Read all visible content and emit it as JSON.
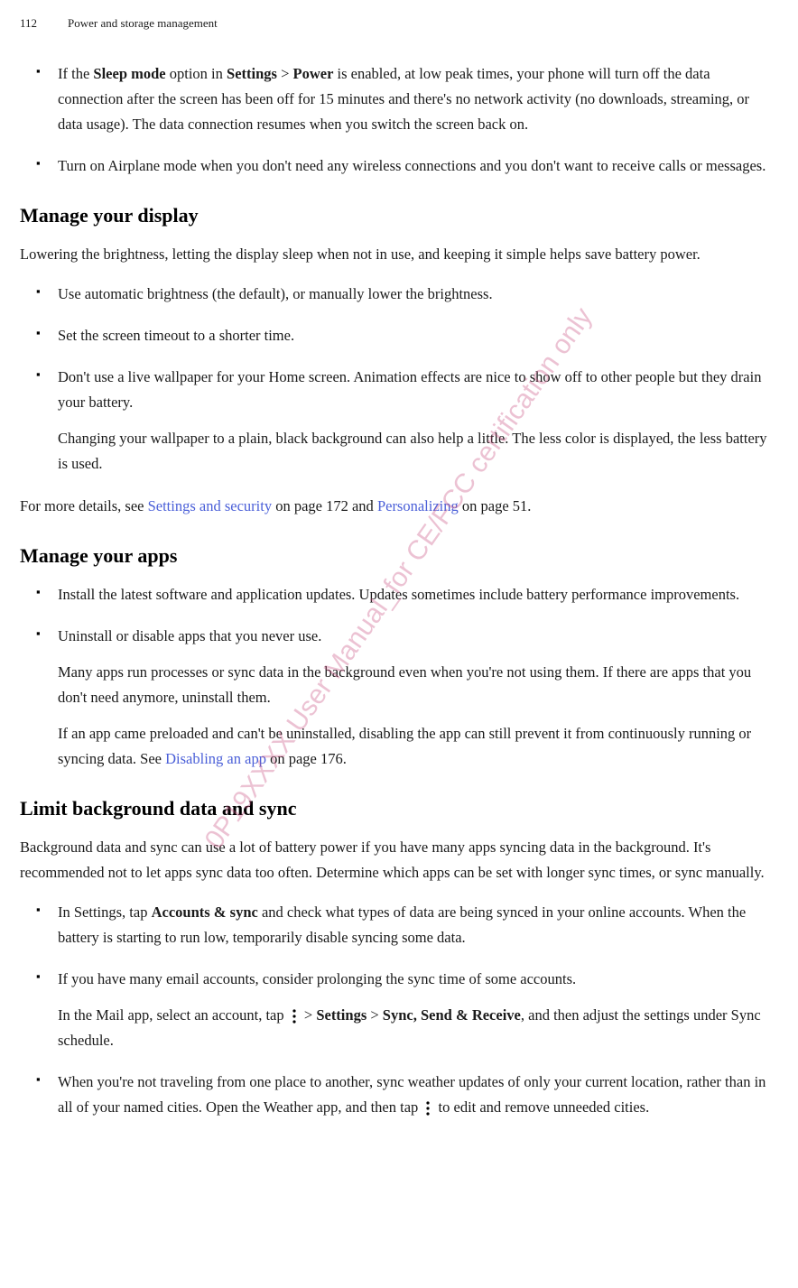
{
  "header": {
    "page_number": "112",
    "title": "Power and storage management"
  },
  "sections": [
    {
      "bullets": [
        {
          "parts": [
            "If the ",
            {
              "b": "Sleep mode"
            },
            " option in ",
            {
              "b": "Settings"
            },
            " > ",
            {
              "b": "Power"
            },
            " is enabled, at low peak times, your phone will turn off the data connection after the screen has been off for 15 minutes and there's no network activity (no downloads, streaming, or data usage). The data connection resumes when you switch the screen back on."
          ]
        },
        {
          "parts": [
            "Turn on Airplane mode when you don't need any wireless connections and you don't want to receive calls or messages."
          ]
        }
      ]
    },
    {
      "title": "Manage your display",
      "intro": "Lowering the brightness, letting the display sleep when not in use, and keeping it simple helps save battery power.",
      "bullets": [
        {
          "parts": [
            "Use automatic brightness (the default), or manually lower the brightness."
          ]
        },
        {
          "parts": [
            "Set the screen timeout to a shorter time."
          ]
        },
        {
          "parts": [
            "Don't use a live wallpaper for your Home screen. Animation effects are nice to show off to other people but they drain your battery."
          ],
          "sub": [
            "Changing your wallpaper to a plain, black background can also help a little. The less color is displayed, the less battery is used."
          ]
        }
      ],
      "outro_parts": [
        "For more details, see ",
        {
          "link": "Settings and security"
        },
        " on page 172 and ",
        {
          "link": "Personalizing"
        },
        " on page 51."
      ]
    },
    {
      "title": "Manage your apps",
      "bullets": [
        {
          "parts": [
            "Install the latest software and application updates. Updates sometimes include battery performance improvements."
          ]
        },
        {
          "parts": [
            "Uninstall or disable apps that you never use."
          ],
          "sub": [
            "Many apps run processes or sync data in the background even when you're not using them. If there are apps that you don't need anymore, uninstall them.",
            [
              "If an app came preloaded and can't be uninstalled, disabling the app can still prevent it from continuously running or syncing data. See ",
              {
                "link": "Disabling an app"
              },
              " on page 176."
            ]
          ]
        }
      ]
    },
    {
      "title": "Limit background data and sync",
      "intro": "Background data and sync can use a lot of battery power if you have many apps syncing data in the background. It's recommended not to let apps sync data too often. Determine which apps can be set with longer sync times, or sync manually.",
      "bullets": [
        {
          "parts": [
            "In Settings, tap ",
            {
              "b": "Accounts & sync"
            },
            " and check what types of data are being synced in your online accounts. When the battery is starting to run low, temporarily disable syncing some data."
          ]
        },
        {
          "parts": [
            "If you have many email accounts, consider prolonging the sync time of some accounts."
          ],
          "sub": [
            [
              "In the Mail app, select an account, tap ",
              {
                "icon": "more-vert"
              },
              " > ",
              {
                "b": "Settings"
              },
              " > ",
              {
                "b": "Sync, Send & Receive"
              },
              ", and then adjust the settings under Sync schedule."
            ]
          ]
        },
        {
          "parts": [
            "When you're not traveling from one place to another, sync weather updates of only your current location, rather than in all of your named cities. Open the Weather app, and then tap ",
            {
              "icon": "more-vert"
            },
            " to edit and remove unneeded cities."
          ]
        }
      ]
    }
  ],
  "watermark": "0P19XXXX User Manual_for CE/FCC certification only"
}
